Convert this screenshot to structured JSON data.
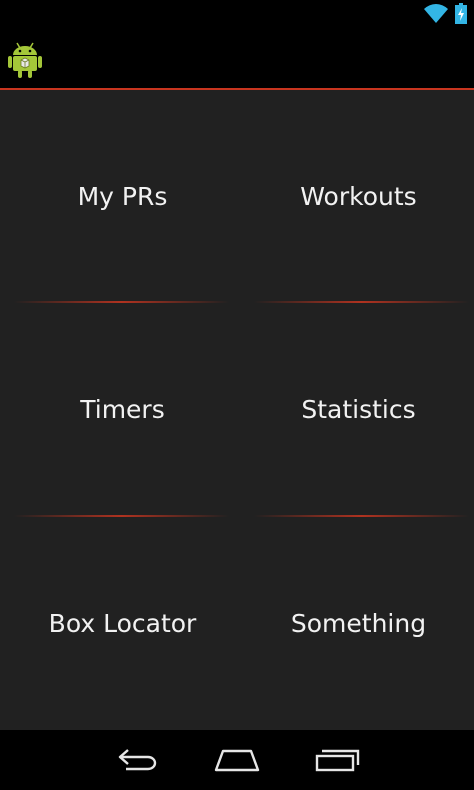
{
  "status_bar": {
    "icons": [
      "wifi-icon",
      "battery-charging-icon"
    ]
  },
  "action_bar": {
    "icon": "android-app-icon"
  },
  "menu": {
    "items": [
      {
        "label": "My PRs"
      },
      {
        "label": "Workouts"
      },
      {
        "label": "Timers"
      },
      {
        "label": "Statistics"
      },
      {
        "label": "Box Locator"
      },
      {
        "label": "Something"
      }
    ]
  },
  "nav_bar": {
    "icons": [
      "back-icon",
      "home-icon",
      "recent-apps-icon"
    ]
  },
  "colors": {
    "accent": "#c9351f",
    "background": "#212121",
    "bar": "#000000",
    "text": "#f2f2f2",
    "status_icon": "#33b5e5",
    "android_green": "#a4c639"
  }
}
